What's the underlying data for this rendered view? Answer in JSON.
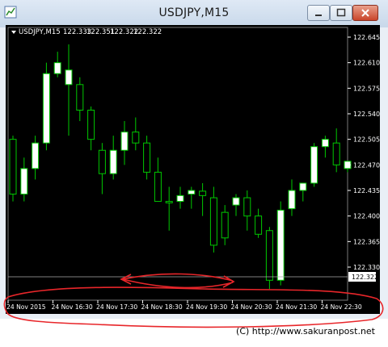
{
  "window": {
    "title": "USDJPY,M15"
  },
  "chart_header": {
    "symbol": "USDJPY,M15",
    "open": "122.333",
    "high": "122.351",
    "low": "122.322",
    "close": "122.322"
  },
  "current_price_label": "122.322",
  "credit": "(C) http://www.sakuranpost.net",
  "colors": {
    "background": "#000000",
    "bull_candle": "#ffffff",
    "candle_outline": "#00c800",
    "axis_text": "#ffffff",
    "annotation": "#e8262a",
    "bid_line": "#aaaaaa"
  },
  "chart_data": {
    "type": "candlestick",
    "title": "USDJPY,M15",
    "y_ticks": [
      "122.645",
      "122.610",
      "122.575",
      "122.540",
      "122.505",
      "122.470",
      "122.435",
      "122.400",
      "122.365",
      "122.330"
    ],
    "x_ticks": [
      "24 Nov 2015",
      "24 Nov 16:30",
      "24 Nov 17:30",
      "24 Nov 18:30",
      "24 Nov 19:30",
      "24 Nov 20:30",
      "24 Nov 21:30",
      "24 Nov 22:30"
    ],
    "ylim": [
      122.3,
      122.66
    ],
    "candles": [
      {
        "o": 122.505,
        "h": 122.51,
        "l": 122.42,
        "c": 122.43
      },
      {
        "o": 122.43,
        "h": 122.48,
        "l": 122.42,
        "c": 122.465
      },
      {
        "o": 122.465,
        "h": 122.51,
        "l": 122.45,
        "c": 122.5
      },
      {
        "o": 122.5,
        "h": 122.61,
        "l": 122.49,
        "c": 122.595
      },
      {
        "o": 122.595,
        "h": 122.625,
        "l": 122.59,
        "c": 122.61
      },
      {
        "o": 122.58,
        "h": 122.635,
        "l": 122.51,
        "c": 122.6
      },
      {
        "o": 122.58,
        "h": 122.59,
        "l": 122.53,
        "c": 122.545
      },
      {
        "o": 122.545,
        "h": 122.55,
        "l": 122.49,
        "c": 122.505
      },
      {
        "o": 122.49,
        "h": 122.5,
        "l": 122.43,
        "c": 122.458
      },
      {
        "o": 122.458,
        "h": 122.51,
        "l": 122.45,
        "c": 122.49
      },
      {
        "o": 122.49,
        "h": 122.53,
        "l": 122.47,
        "c": 122.515
      },
      {
        "o": 122.515,
        "h": 122.535,
        "l": 122.49,
        "c": 122.5
      },
      {
        "o": 122.5,
        "h": 122.51,
        "l": 122.45,
        "c": 122.46
      },
      {
        "o": 122.46,
        "h": 122.48,
        "l": 122.42,
        "c": 122.42
      },
      {
        "o": 122.42,
        "h": 122.44,
        "l": 122.38,
        "c": 122.418
      },
      {
        "o": 122.42,
        "h": 122.44,
        "l": 122.41,
        "c": 122.428
      },
      {
        "o": 122.43,
        "h": 122.44,
        "l": 122.41,
        "c": 122.435
      },
      {
        "o": 122.434,
        "h": 122.445,
        "l": 122.4,
        "c": 122.428
      },
      {
        "o": 122.425,
        "h": 122.44,
        "l": 122.35,
        "c": 122.36
      },
      {
        "o": 122.405,
        "h": 122.415,
        "l": 122.36,
        "c": 122.37
      },
      {
        "o": 122.415,
        "h": 122.43,
        "l": 122.4,
        "c": 122.425
      },
      {
        "o": 122.425,
        "h": 122.435,
        "l": 122.38,
        "c": 122.4
      },
      {
        "o": 122.4,
        "h": 122.41,
        "l": 122.37,
        "c": 122.375
      },
      {
        "o": 122.38,
        "h": 122.385,
        "l": 122.3,
        "c": 122.312
      },
      {
        "o": 122.312,
        "h": 122.42,
        "l": 122.305,
        "c": 122.408
      },
      {
        "o": 122.41,
        "h": 122.45,
        "l": 122.4,
        "c": 122.435
      },
      {
        "o": 122.435,
        "h": 122.445,
        "l": 122.42,
        "c": 122.445
      },
      {
        "o": 122.445,
        "h": 122.5,
        "l": 122.44,
        "c": 122.495
      },
      {
        "o": 122.495,
        "h": 122.51,
        "l": 122.48,
        "c": 122.505
      },
      {
        "o": 122.5,
        "h": 122.52,
        "l": 122.46,
        "c": 122.47
      },
      {
        "o": 122.465,
        "h": 122.475,
        "l": 122.46,
        "c": 122.475
      }
    ]
  }
}
